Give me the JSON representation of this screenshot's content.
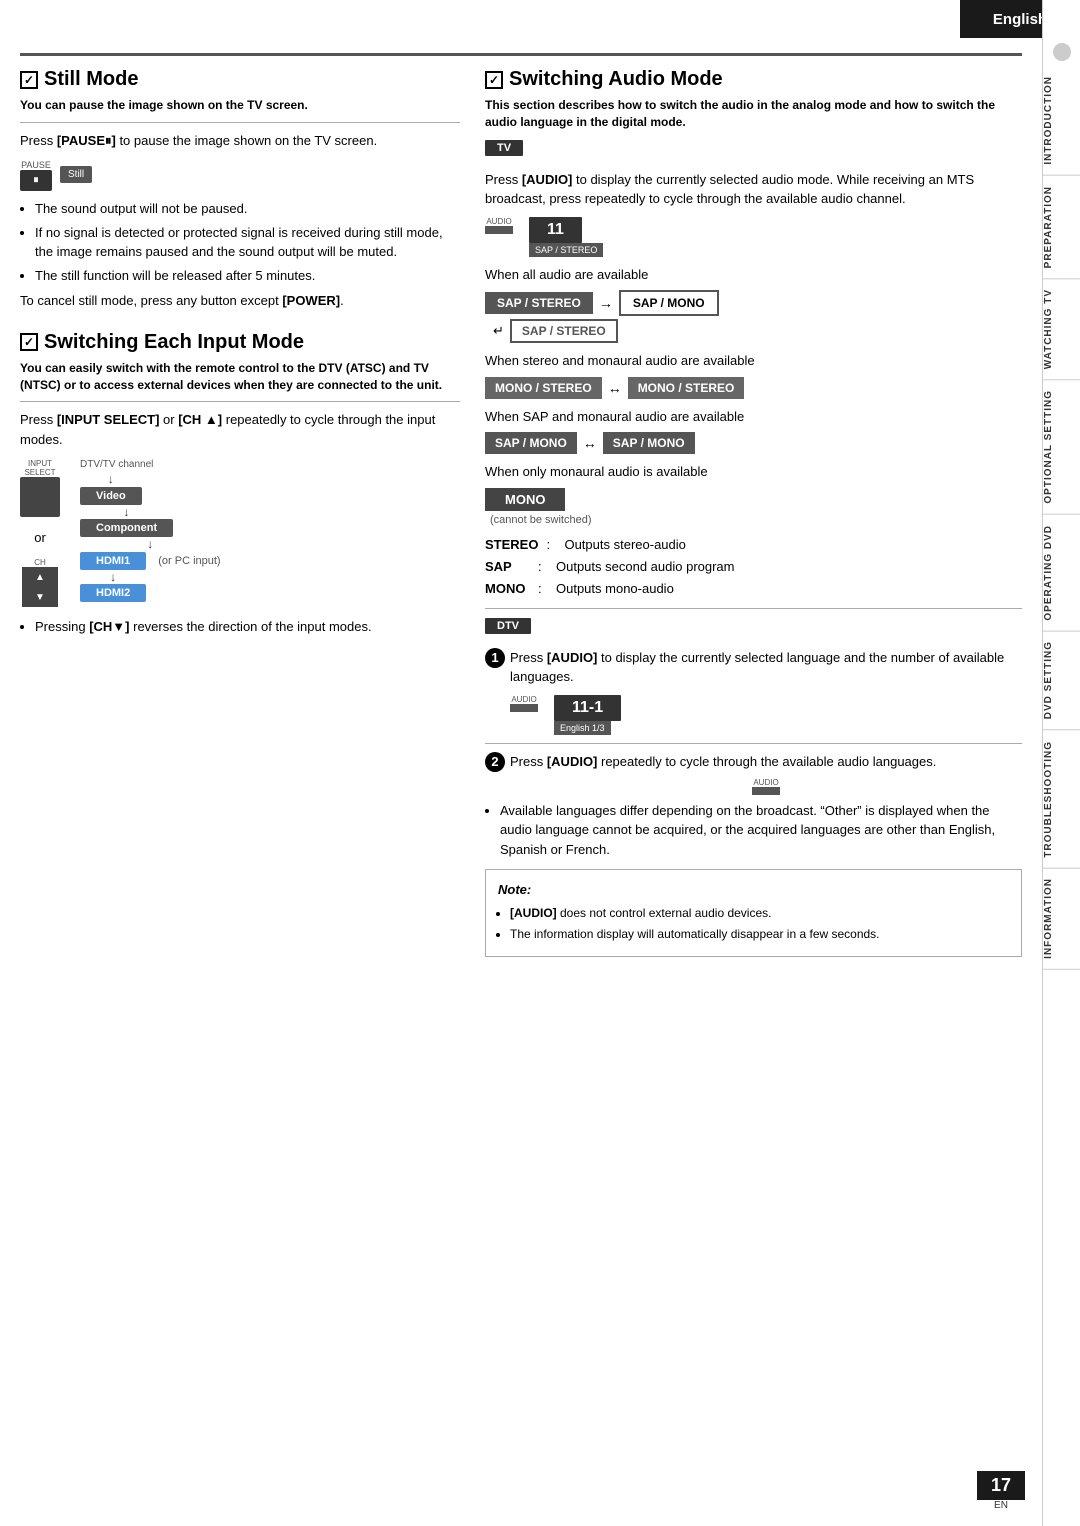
{
  "header": {
    "language": "English"
  },
  "sidebar": {
    "sections": [
      "INTRODUCTION",
      "PREPARATION",
      "WATCHING TV",
      "OPTIONAL SETTING",
      "OPERATING DVD",
      "DVD SETTING",
      "TROUBLESHOOTING",
      "INFORMATION"
    ]
  },
  "still_mode": {
    "title": "Still Mode",
    "subtitle": "You can pause the image shown on the TV screen.",
    "body1": "Press ",
    "bold1": "[PAUSE⏸]",
    "body1b": " to pause the image shown on the TV screen.",
    "pause_label": "PAUSE",
    "pause_button": "⏸",
    "still_label": "Still",
    "bullets": [
      "The sound output will not be paused.",
      "If no signal is detected or protected signal is received during still mode, the image remains paused and the sound output will be muted.",
      "The still function will be released after 5 minutes."
    ],
    "cancel_text": "To cancel still mode, press any button except ",
    "cancel_bold": "[POWER]",
    "cancel_end": "."
  },
  "switching_each_input": {
    "title": "Switching Each Input Mode",
    "subtitle": "You can easily switch with the remote control to the DTV (ATSC) and TV (NTSC) or to access external devices when they are connected to the unit.",
    "body1": "Press ",
    "bold1": "[INPUT SELECT]",
    "body1b": " or ",
    "bold2": "[CH ▲]",
    "body1c": " repeatedly to cycle through the input modes.",
    "input_label": "INPUT\nSELECT",
    "ch_label": "CH",
    "or_text": "or",
    "dtv_channel": "DTV/TV channel",
    "flow_items": [
      "Video",
      "Component",
      "HDMI1",
      "HDMI2"
    ],
    "pc_note": "(or PC input)",
    "bullet_ch": "Pressing ",
    "bullet_ch_bold": "[CH▼]",
    "bullet_ch_end": " reverses the direction of the input modes."
  },
  "switching_audio": {
    "title": "Switching Audio Mode",
    "subtitle": "This section describes how to switch the audio in the analog mode and how to switch the audio language in the digital mode.",
    "tv_badge": "TV",
    "body1": "Press ",
    "bold1": "[AUDIO]",
    "body1b": " to display the currently selected audio mode. While receiving an MTS broadcast, press repeatedly to cycle through the available audio channel.",
    "audio_label": "AUDIO",
    "display_num": "11",
    "display_sub": "SAP / STEREO",
    "when1": "When all audio are available",
    "sap_stereo_dark": "SAP / STEREO",
    "arrow1": "→",
    "sap_mono_outline": "SAP / MONO",
    "back_arrow": "↵",
    "sap_stereo_outline_back": "SAP / STEREO",
    "when2": "When stereo and monaural audio are available",
    "mono_stereo1": "MONO / STEREO",
    "arrow_lr1": "↔",
    "mono_stereo2": "MONO / STEREO",
    "when3": "When SAP and monaural audio are available",
    "sap_mono1": "SAP / MONO",
    "arrow_lr2": "↔",
    "sap_mono2": "SAP / MONO",
    "when4": "When only monaural audio is available",
    "mono_only": "MONO",
    "cannot_switch": "(cannot be switched)",
    "defs": [
      {
        "label": "STEREO",
        "colon": ":",
        "value": "Outputs stereo-audio"
      },
      {
        "label": "SAP",
        "colon": ":",
        "value": "Outputs second audio program"
      },
      {
        "label": "MONO",
        "colon": ":",
        "value": "Outputs mono-audio"
      }
    ],
    "dtv_badge": "DTV",
    "step1_text1": "Press ",
    "step1_bold": "[AUDIO]",
    "step1_text2": " to display the currently selected language and the number of available languages.",
    "display_num2": "11-1",
    "display_sub2": "English 1/3",
    "step2_text1": "Press ",
    "step2_bold": "[AUDIO]",
    "step2_text2": " repeatedly to cycle through the available audio languages.",
    "bullet_avail": "Available languages differ depending on the broadcast. “Other” is displayed when the audio language cannot be acquired, or the acquired languages are other than English, Spanish or French.",
    "note_title": "Note:",
    "note_items": [
      "[AUDIO] does not control external audio devices.",
      "The information display will automatically disappear in a few seconds."
    ]
  },
  "page": {
    "number": "17",
    "en_label": "EN"
  }
}
